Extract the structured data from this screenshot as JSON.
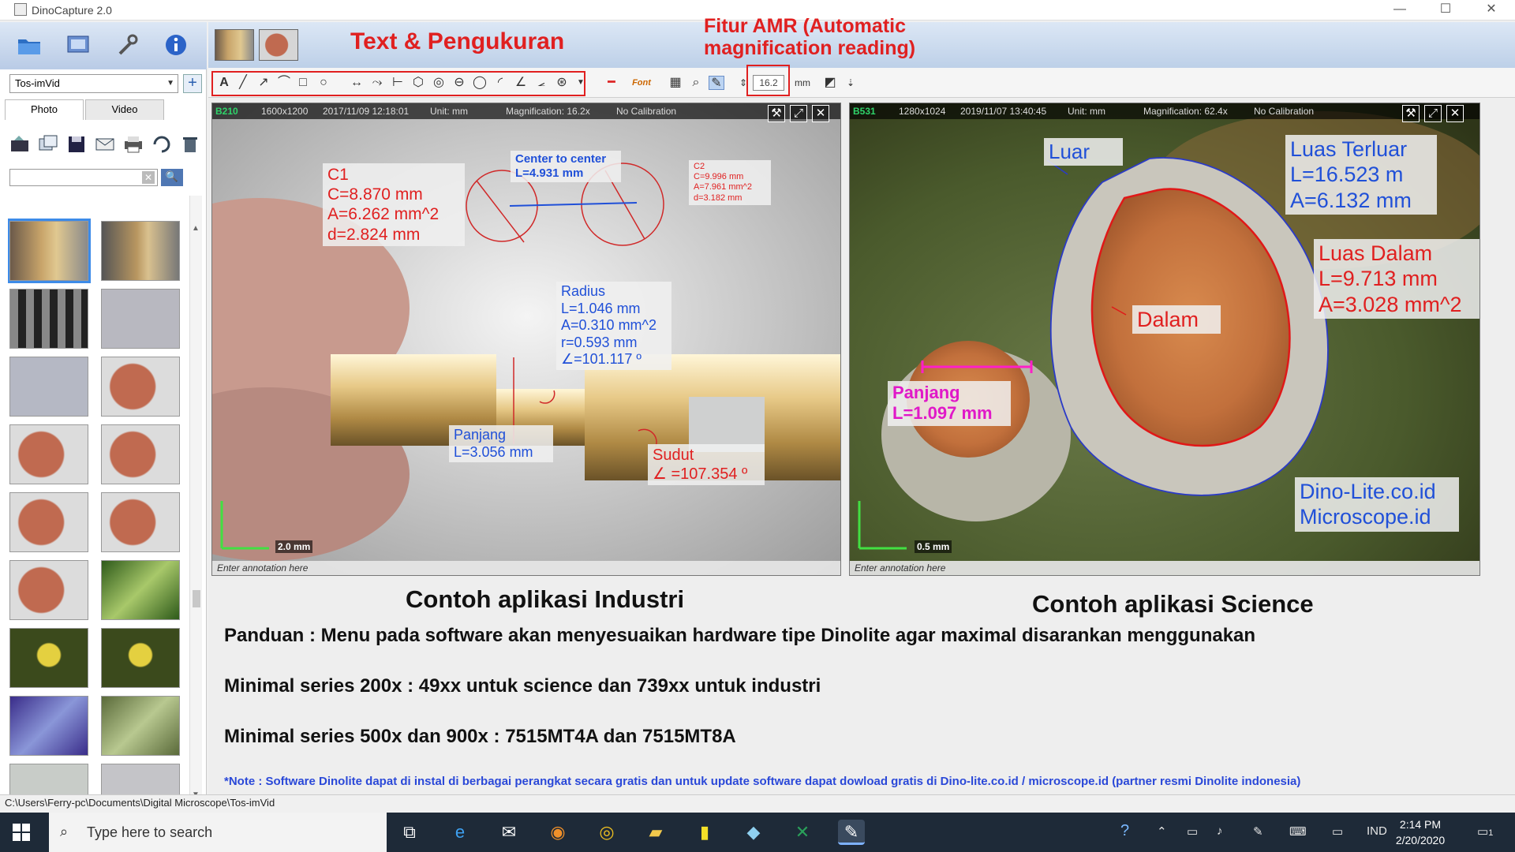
{
  "window": {
    "title": "DinoCapture 2.0",
    "min": "—",
    "max": "☐",
    "close": "✕"
  },
  "sidebar": {
    "folder_combo": "Tos-imVid",
    "plus": "+",
    "tabs": [
      "Photo",
      "Video"
    ],
    "search_clear": "✕",
    "search_btn": "🔍"
  },
  "annotations": {
    "text_measure": "Text & Pengukuran",
    "amr_line1": "Fitur AMR (Automatic",
    "amr_line2": "magnification reading)"
  },
  "toolbar": {
    "magnification": "16.2",
    "unit_dropdown": "mm"
  },
  "viewer_left": {
    "model": "B210",
    "resolution": "1600x1200",
    "datetime": "2017/11/09 12:18:01",
    "unit": "Unit: mm",
    "magnification": "Magnification: 16.2x",
    "calibration": "No Calibration",
    "scale": "2.0 mm",
    "annotation_placeholder": "Enter annotation here",
    "labels": {
      "c1": [
        "C1",
        "C=8.870 mm",
        "A=6.262 mm^2",
        "d=2.824 mm"
      ],
      "center": [
        "Center to center",
        "L=4.931 mm"
      ],
      "c2": [
        "C2",
        "C=9.996 mm",
        "A=7.961 mm^2",
        "d=3.182 mm"
      ],
      "radius": [
        "Radius",
        "L=1.046 mm",
        "A=0.310 mm^2",
        "r=0.593 mm",
        "∠=101.117 º"
      ],
      "panjang": [
        "Panjang",
        "L=3.056 mm"
      ],
      "sudut": [
        "Sudut",
        "∠ =107.354 º"
      ]
    }
  },
  "viewer_right": {
    "model": "B531",
    "resolution": "1280x1024",
    "datetime": "2019/11/07 13:40:45",
    "unit": "Unit: mm",
    "magnification": "Magnification: 62.4x",
    "calibration": "No Calibration",
    "scale": "0.5 mm",
    "annotation_placeholder": "Enter annotation here",
    "labels": {
      "luar": "Luar",
      "luas_terluar": [
        "Luas Terluar",
        "L=16.523 m",
        "A=6.132 mm"
      ],
      "luas_dalam": [
        "Luas Dalam",
        "L=9.713 mm",
        "A=3.028 mm^2"
      ],
      "dalam": "Dalam",
      "panjang": [
        "Panjang",
        "L=1.097 mm"
      ],
      "brand": [
        "Dino-Lite.co.id",
        "Microscope.id"
      ]
    }
  },
  "captions": {
    "industri": "Contoh aplikasi Industri",
    "science": "Contoh aplikasi Science",
    "guide1": "Panduan : Menu pada software akan menyesuaikan hardware tipe Dinolite agar maximal disarankan menggunakan",
    "guide2": "Minimal series 200x : 49xx untuk science dan 739xx untuk industri",
    "guide3": "Minimal series 500x dan 900x : 7515MT4A dan 7515MT8A",
    "note": "*Note : Software Dinolite dapat di instal di berbagai perangkat secara gratis dan untuk update software dapat dowload gratis di Dino-lite.co.id / microscope.id (partner resmi Dinolite indonesia)"
  },
  "status": {
    "path": "C:\\Users\\Ferry-pc\\Documents\\Digital Microscope\\Tos-imVid"
  },
  "taskbar": {
    "search_placeholder": "Type here to search",
    "language": "IND",
    "time": "2:14 PM",
    "date": "2/20/2020",
    "notification_count": "1"
  }
}
